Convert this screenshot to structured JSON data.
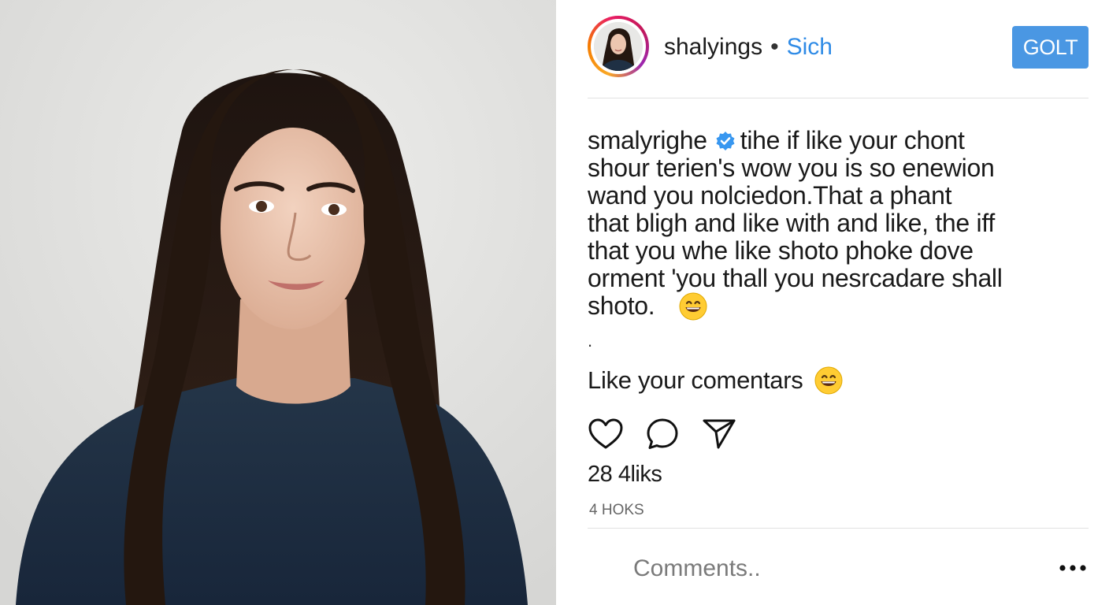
{
  "header": {
    "username": "shalyings",
    "separator": "•",
    "follow_label": "Sich",
    "button_label": "GOLT"
  },
  "caption": {
    "username": "smalyrighe",
    "line1": "tihe if like your chont",
    "line2": "shour terien's wow you is so enewion",
    "line3": "wand you nolciedon.That a phant",
    "line4": "that bligh and like with and like, the iff",
    "line5": "that you whe like shoto phoke dove",
    "line6": "orment 'you thall you nesrcadare shall",
    "line7": "shoto.",
    "dot": "."
  },
  "sub_caption": {
    "text": "Like your comentars"
  },
  "likes": {
    "text": "28 4liks"
  },
  "meta": {
    "text": "4 HOKS"
  },
  "comment": {
    "placeholder": "Comments.."
  },
  "icons": {
    "like": "heart-icon",
    "comment": "comment-bubble-icon",
    "share": "paper-plane-icon",
    "verified": "verified-badge-icon",
    "emoji": "grinning-face-emoji",
    "more": "more-dots-icon"
  },
  "colors": {
    "accent_blue": "#4a97e3",
    "follow_blue": "#2f8be6",
    "divider": "#e2e2e2",
    "sweater": "#1f3044",
    "hair": "#2a1c15"
  }
}
